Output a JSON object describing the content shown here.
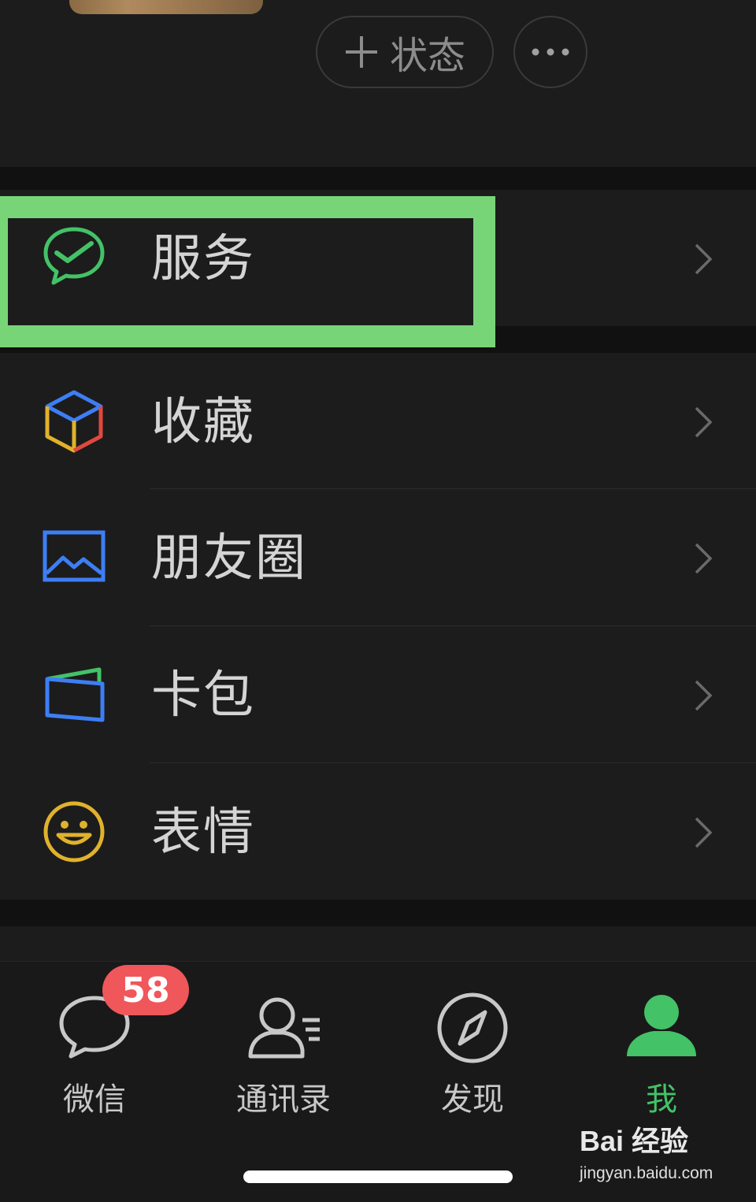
{
  "profile": {
    "status_label": "状态"
  },
  "menu": {
    "services": "服务",
    "favorites": "收藏",
    "moments": "朋友圈",
    "cards": "卡包",
    "stickers": "表情"
  },
  "tabs": {
    "chats": "微信",
    "chats_badge": "58",
    "contacts": "通讯录",
    "discover": "发现",
    "me": "我"
  },
  "watermark": {
    "brand": "Bai 经验",
    "url": "jingyan.baidu.com"
  },
  "colors": {
    "accent": "#07c160",
    "highlight": "#77d577",
    "badge": "#f0575a"
  }
}
